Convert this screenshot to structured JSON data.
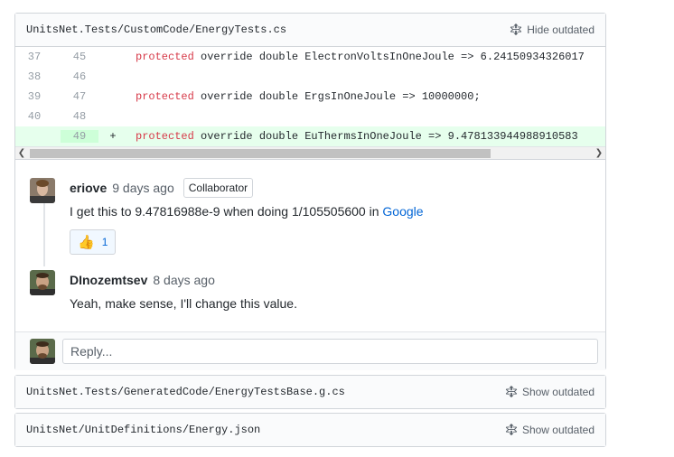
{
  "file1": {
    "path": "UnitsNet.Tests/CustomCode/EnergyTests.cs",
    "toggle_label": "Hide outdated",
    "lines": [
      {
        "old": "37",
        "new": "45",
        "marker": "",
        "kw": "protected",
        "rest": " override double ElectronVoltsInOneJoule => 6.24150934326017",
        "added": false
      },
      {
        "old": "38",
        "new": "46",
        "marker": "",
        "kw": "",
        "rest": "",
        "added": false
      },
      {
        "old": "39",
        "new": "47",
        "marker": "",
        "kw": "protected",
        "rest": " override double ErgsInOneJoule => 10000000;",
        "added": false
      },
      {
        "old": "40",
        "new": "48",
        "marker": "",
        "kw": "",
        "rest": "",
        "added": false
      },
      {
        "old": "",
        "new": "49",
        "marker": "+",
        "kw": "protected",
        "rest": " override double EuThermsInOneJoule => 9.478133944988910583",
        "added": true
      }
    ]
  },
  "comments": [
    {
      "author": "eriove",
      "time": "9 days ago",
      "badge": "Collaborator",
      "text_before": "I get this to 9.47816988e-9 when doing 1/105505600 in ",
      "link": "Google",
      "reaction_emoji": "👍",
      "reaction_count": "1"
    },
    {
      "author": "DInozemtsev",
      "time": "8 days ago",
      "text": "Yeah, make sense, I'll change this value."
    }
  ],
  "reply": {
    "placeholder": "Reply..."
  },
  "file2": {
    "path": "UnitsNet.Tests/GeneratedCode/EnergyTestsBase.g.cs",
    "toggle_label": "Show outdated"
  },
  "file3": {
    "path": "UnitsNet/UnitDefinitions/Energy.json",
    "toggle_label": "Show outdated"
  },
  "icons": {
    "unfold": "unfold-icon",
    "thumbs_up": "thumbs-up-icon"
  },
  "colors": {
    "link": "#0366d6",
    "keyword": "#d73a49",
    "added_bg": "#e6ffed"
  }
}
